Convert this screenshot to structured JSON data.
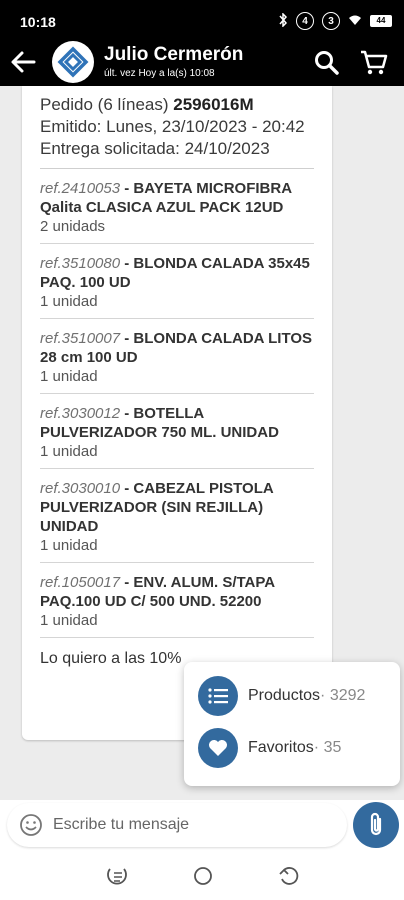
{
  "status_bar": {
    "time": "10:18",
    "indicator_1": "4",
    "indicator_2": "3",
    "battery": "44"
  },
  "header": {
    "contact_name": "Julio Cermerón",
    "last_seen": "últ. vez Hoy a la(s) 10:08"
  },
  "order": {
    "line1_prefix": "Pedido (6 líneas)",
    "order_number": "2596016M",
    "line2": "Emitido: Lunes, 23/10/2023 - 20:42",
    "line3": "Entrega solicitada: 24/10/2023",
    "items": [
      {
        "ref": "ref.2410053",
        "name": "BAYETA MICROFIBRA Qalita CLASICA AZUL PACK 12UD",
        "qty": "2 unidads"
      },
      {
        "ref": "ref.3510080",
        "name": "BLONDA CALADA 35x45 PAQ. 100 UD",
        "qty": "1 unidad"
      },
      {
        "ref": "ref.3510007",
        "name": "BLONDA CALADA LITOS 28 cm 100 UD",
        "qty": "1 unidad"
      },
      {
        "ref": "ref.3030012",
        "name": "BOTELLA PULVERIZADOR 750 ML. UNIDAD",
        "qty": "1 unidad"
      },
      {
        "ref": "ref.3030010",
        "name": "CABEZAL PISTOLA PULVERIZADOR (SIN REJILLA) UNIDAD",
        "qty": "1 unidad"
      },
      {
        "ref": "ref.1050017",
        "name": "ENV. ALUM. S/TAPA PAQ.100 UD C/ 500 UND. 52200",
        "qty": "1 unidad"
      }
    ],
    "closing": "Lo quiero a las 10%"
  },
  "popup": {
    "productos_label": "Productos",
    "productos_count": "· 3292",
    "favoritos_label": "Favoritos",
    "favoritos_count": "· 35"
  },
  "input": {
    "placeholder": "Escribe tu mensaje"
  },
  "colors": {
    "accent": "#336a9e",
    "header_bg": "#000000",
    "chat_bg": "#ececec"
  },
  "icons": [
    "back-arrow-icon",
    "search-icon",
    "cart-icon",
    "list-icon",
    "heart-icon",
    "emoji-icon",
    "paperclip-icon"
  ]
}
